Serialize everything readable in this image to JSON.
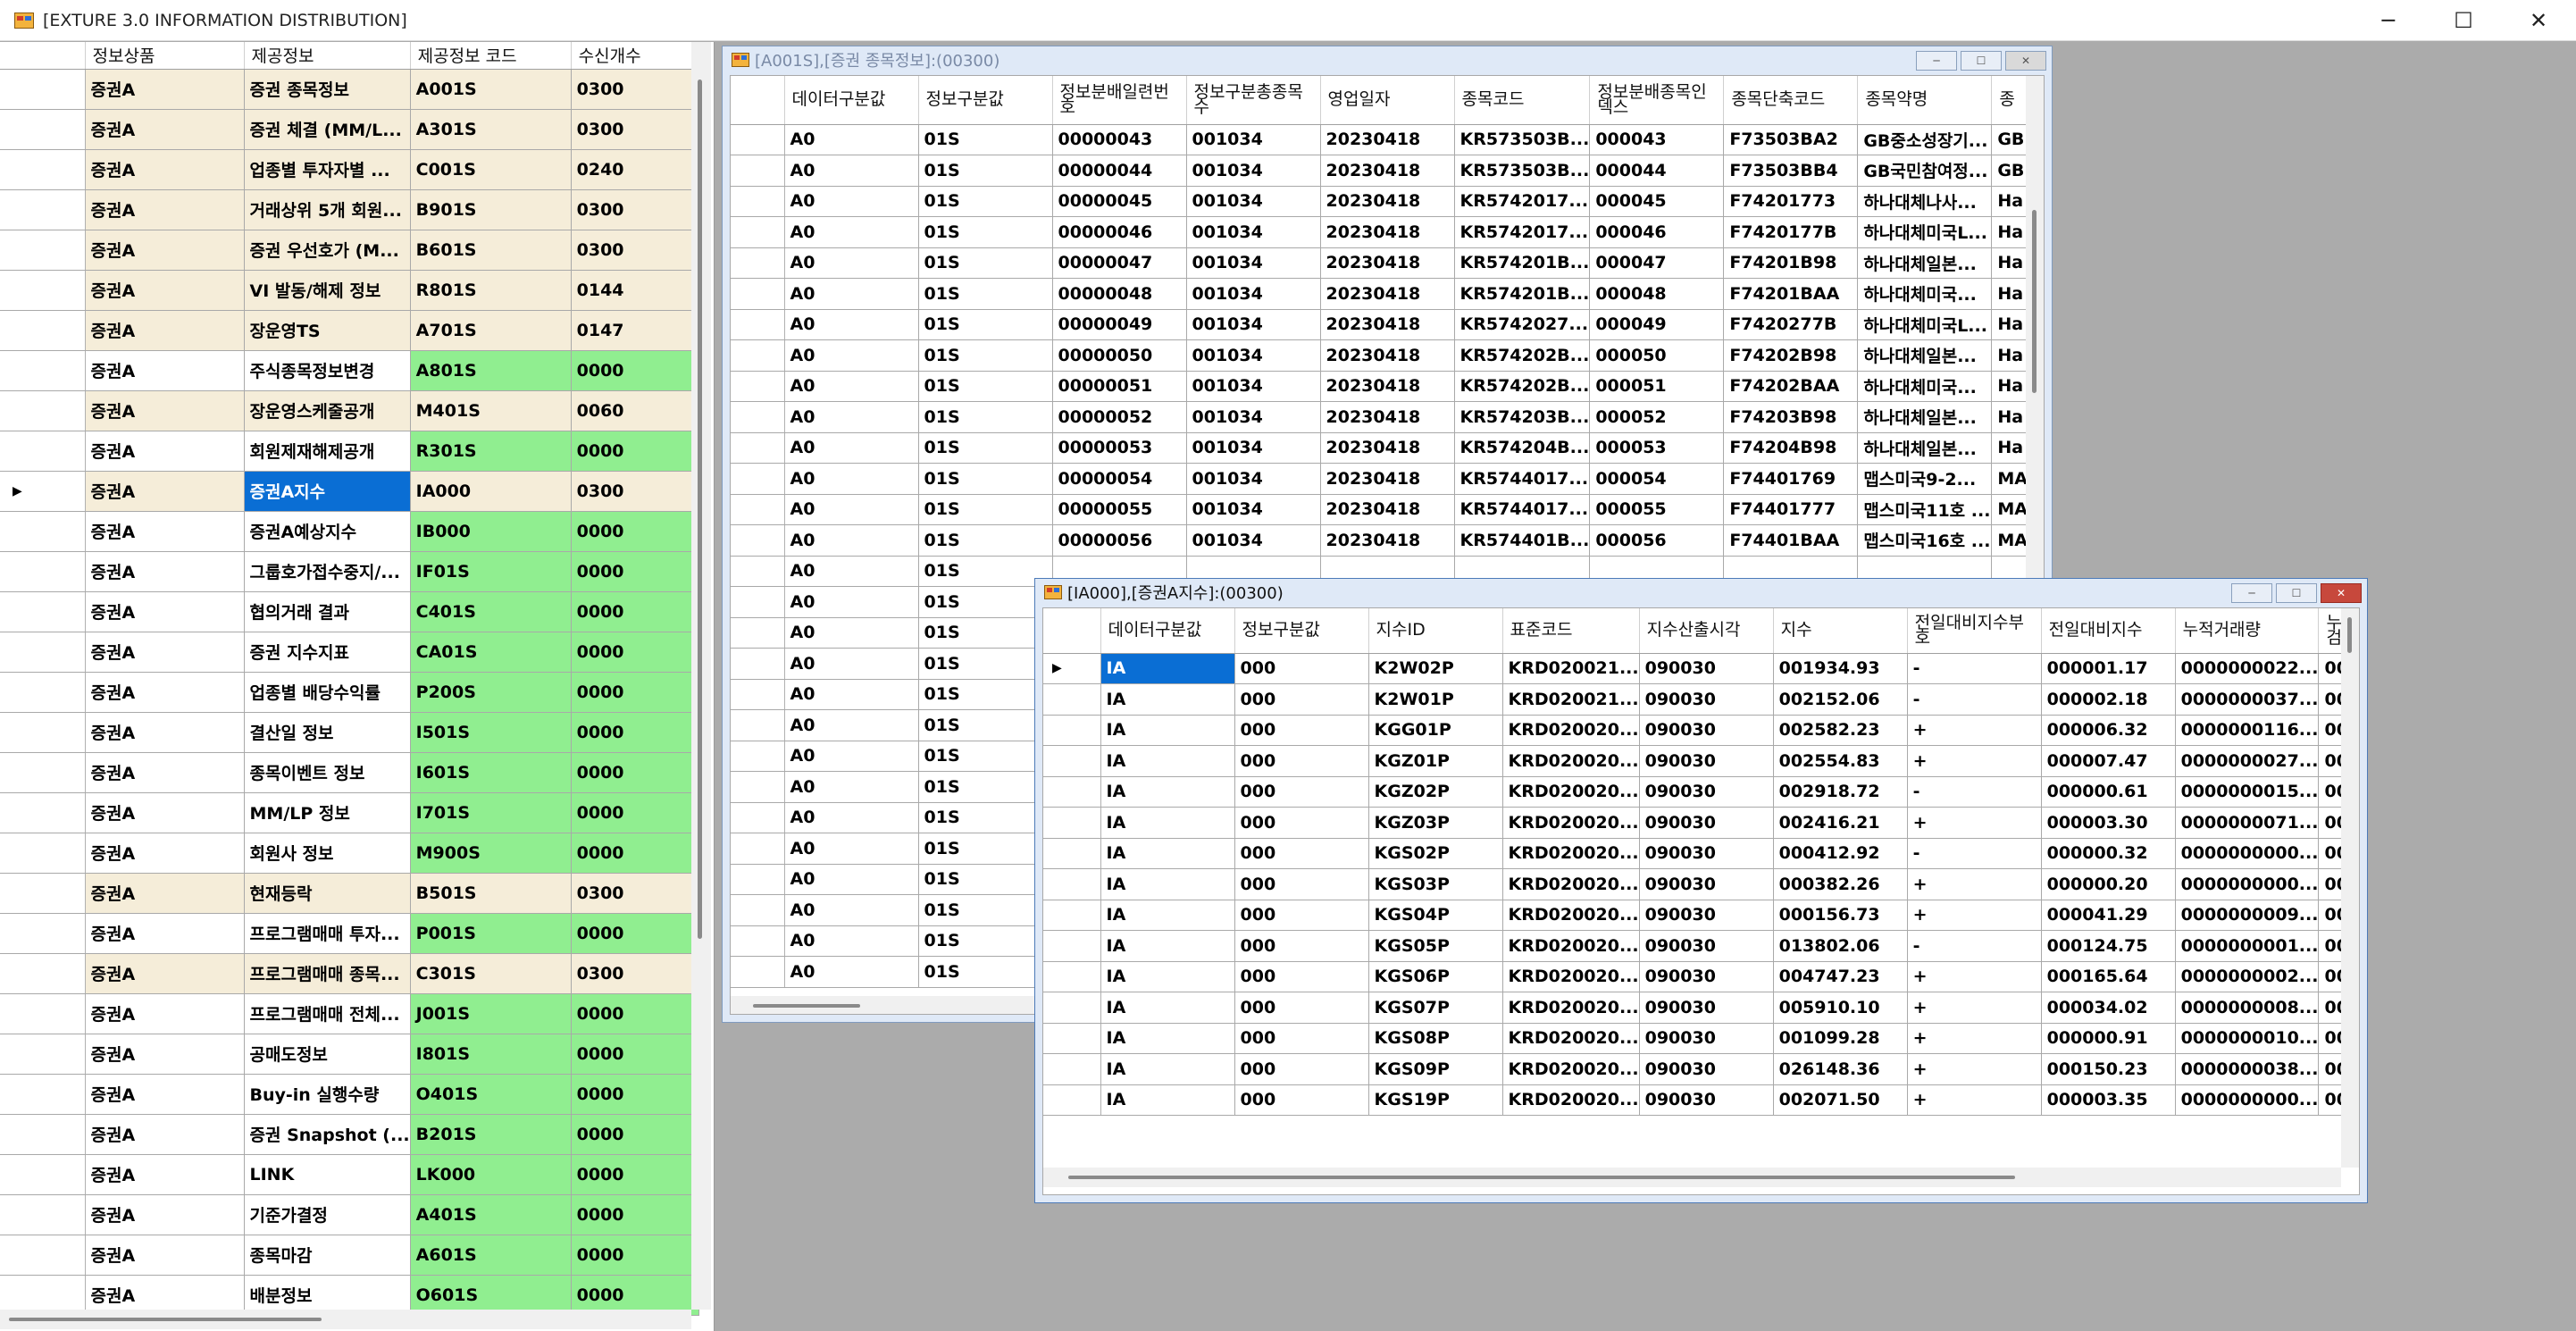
{
  "app": {
    "title": "[EXTURE 3.0 INFORMATION DISTRIBUTION]",
    "minimize": "─",
    "maximize": "☐",
    "close": "✕"
  },
  "colors": {
    "ok": "#90ee90",
    "default": "#f5edd9",
    "selection": "#0a6ed4"
  },
  "left_grid": {
    "columns": [
      "",
      "정보상품",
      "제공정보",
      "제공정보 코드",
      "수신개수"
    ],
    "rows": [
      {
        "product": "증권A",
        "info": "증권 종목정보",
        "code": "A001S",
        "count": "0300",
        "status": "default"
      },
      {
        "product": "증권A",
        "info": "증권 체결 (MM/L...",
        "code": "A301S",
        "count": "0300",
        "status": "default"
      },
      {
        "product": "증권A",
        "info": "업종별 투자자별 ...",
        "code": "C001S",
        "count": "0240",
        "status": "default"
      },
      {
        "product": "증권A",
        "info": "거래상위 5개 회원...",
        "code": "B901S",
        "count": "0300",
        "status": "default"
      },
      {
        "product": "증권A",
        "info": "증권 우선호가 (M...",
        "code": "B601S",
        "count": "0300",
        "status": "default"
      },
      {
        "product": "증권A",
        "info": "VI 발동/해제 정보",
        "code": "R801S",
        "count": "0144",
        "status": "default"
      },
      {
        "product": "증권A",
        "info": "장운영TS",
        "code": "A701S",
        "count": "0147",
        "status": "default"
      },
      {
        "product": "증권A",
        "info": "주식종목정보변경",
        "code": "A801S",
        "count": "0000",
        "status": "ok"
      },
      {
        "product": "증권A",
        "info": "장운영스케줄공개",
        "code": "M401S",
        "count": "0060",
        "status": "default"
      },
      {
        "product": "증권A",
        "info": "회원제재해제공개",
        "code": "R301S",
        "count": "0000",
        "status": "ok"
      },
      {
        "product": "증권A",
        "info": "증권A지수",
        "code": "IA000",
        "count": "0300",
        "status": "default",
        "selected": true,
        "current": true
      },
      {
        "product": "증권A",
        "info": "증권A예상지수",
        "code": "IB000",
        "count": "0000",
        "status": "ok"
      },
      {
        "product": "증권A",
        "info": "그룹호가접수중지/...",
        "code": "IF01S",
        "count": "0000",
        "status": "ok"
      },
      {
        "product": "증권A",
        "info": "협의거래 결과",
        "code": "C401S",
        "count": "0000",
        "status": "ok"
      },
      {
        "product": "증권A",
        "info": "증권 지수지표",
        "code": "CA01S",
        "count": "0000",
        "status": "ok"
      },
      {
        "product": "증권A",
        "info": "업종별 배당수익률",
        "code": "P200S",
        "count": "0000",
        "status": "ok"
      },
      {
        "product": "증권A",
        "info": "결산일 정보",
        "code": "I501S",
        "count": "0000",
        "status": "ok"
      },
      {
        "product": "증권A",
        "info": "종목이벤트 정보",
        "code": "I601S",
        "count": "0000",
        "status": "ok"
      },
      {
        "product": "증권A",
        "info": "MM/LP 정보",
        "code": "I701S",
        "count": "0000",
        "status": "ok"
      },
      {
        "product": "증권A",
        "info": "회원사 정보",
        "code": "M900S",
        "count": "0000",
        "status": "ok"
      },
      {
        "product": "증권A",
        "info": "현재등락",
        "code": "B501S",
        "count": "0300",
        "status": "default"
      },
      {
        "product": "증권A",
        "info": "프로그램매매 투자...",
        "code": "P001S",
        "count": "0000",
        "status": "ok"
      },
      {
        "product": "증권A",
        "info": "프로그램매매 종목...",
        "code": "C301S",
        "count": "0300",
        "status": "default"
      },
      {
        "product": "증권A",
        "info": "프로그램매매 전체...",
        "code": "J001S",
        "count": "0000",
        "status": "ok"
      },
      {
        "product": "증권A",
        "info": "공매도정보",
        "code": "I801S",
        "count": "0000",
        "status": "ok"
      },
      {
        "product": "증권A",
        "info": "Buy-in 실행수량",
        "code": "O401S",
        "count": "0000",
        "status": "ok"
      },
      {
        "product": "증권A",
        "info": "증권 Snapshot (...",
        "code": "B201S",
        "count": "0000",
        "status": "ok"
      },
      {
        "product": "증권A",
        "info": "LINK",
        "code": "LK000",
        "count": "0000",
        "status": "ok"
      },
      {
        "product": "증권A",
        "info": "기준가결정",
        "code": "A401S",
        "count": "0000",
        "status": "ok"
      },
      {
        "product": "증권A",
        "info": "종목마감",
        "code": "A601S",
        "count": "0000",
        "status": "ok"
      },
      {
        "product": "증권A",
        "info": "배분정보",
        "code": "O601S",
        "count": "0000",
        "status": "ok"
      }
    ]
  },
  "window_a001s": {
    "title": "[A001S],[증권 종목정보]:(00300)",
    "columns": [
      "",
      "데이터구분값",
      "정보구분값",
      "정보분배일련번호",
      "정보구분총종목수",
      "영업일자",
      "종목코드",
      "정보분배종목인덱스",
      "종목단축코드",
      "종목약명",
      "종"
    ],
    "rows": [
      [
        "A0",
        "01S",
        "00000043",
        "001034",
        "20230418",
        "KR573503B...",
        "000043",
        "F73503BA2",
        "GB중소성장기...",
        "GB"
      ],
      [
        "A0",
        "01S",
        "00000044",
        "001034",
        "20230418",
        "KR573503B...",
        "000044",
        "F73503BB4",
        "GB국민참여정...",
        "GB"
      ],
      [
        "A0",
        "01S",
        "00000045",
        "001034",
        "20230418",
        "KR5742017...",
        "000045",
        "F74201773",
        "하나대체나사...",
        "Ha"
      ],
      [
        "A0",
        "01S",
        "00000046",
        "001034",
        "20230418",
        "KR5742017...",
        "000046",
        "F7420177B",
        "하나대체미국L...",
        "Ha"
      ],
      [
        "A0",
        "01S",
        "00000047",
        "001034",
        "20230418",
        "KR574201B...",
        "000047",
        "F74201B98",
        "하나대체일본...",
        "Ha"
      ],
      [
        "A0",
        "01S",
        "00000048",
        "001034",
        "20230418",
        "KR574201B...",
        "000048",
        "F74201BAA",
        "하나대체미국...",
        "Ha"
      ],
      [
        "A0",
        "01S",
        "00000049",
        "001034",
        "20230418",
        "KR5742027...",
        "000049",
        "F7420277B",
        "하나대체미국L...",
        "Ha"
      ],
      [
        "A0",
        "01S",
        "00000050",
        "001034",
        "20230418",
        "KR574202B...",
        "000050",
        "F74202B98",
        "하나대체일본...",
        "Ha"
      ],
      [
        "A0",
        "01S",
        "00000051",
        "001034",
        "20230418",
        "KR574202B...",
        "000051",
        "F74202BAA",
        "하나대체미국...",
        "Ha"
      ],
      [
        "A0",
        "01S",
        "00000052",
        "001034",
        "20230418",
        "KR574203B...",
        "000052",
        "F74203B98",
        "하나대체일본...",
        "Ha"
      ],
      [
        "A0",
        "01S",
        "00000053",
        "001034",
        "20230418",
        "KR574204B...",
        "000053",
        "F74204B98",
        "하나대체일본...",
        "Ha"
      ],
      [
        "A0",
        "01S",
        "00000054",
        "001034",
        "20230418",
        "KR5744017...",
        "000054",
        "F74401769",
        "맵스미국9-2...",
        "MA"
      ],
      [
        "A0",
        "01S",
        "00000055",
        "001034",
        "20230418",
        "KR5744017...",
        "000055",
        "F74401777",
        "맵스미국11호 ...",
        "MA"
      ],
      [
        "A0",
        "01S",
        "00000056",
        "001034",
        "20230418",
        "KR574401B...",
        "000056",
        "F74401BAA",
        "맵스미국16호 ...",
        "MA"
      ],
      [
        "A0",
        "01S",
        "",
        "",
        "",
        "",
        "",
        "",
        "",
        ""
      ],
      [
        "A0",
        "01S",
        "",
        "",
        "",
        "",
        "",
        "",
        "",
        ""
      ],
      [
        "A0",
        "01S",
        "",
        "",
        "",
        "",
        "",
        "",
        "",
        ""
      ],
      [
        "A0",
        "01S",
        "",
        "",
        "",
        "",
        "",
        "",
        "",
        ""
      ],
      [
        "A0",
        "01S",
        "",
        "",
        "",
        "",
        "",
        "",
        "",
        ""
      ],
      [
        "A0",
        "01S",
        "",
        "",
        "",
        "",
        "",
        "",
        "",
        ""
      ],
      [
        "A0",
        "01S",
        "",
        "",
        "",
        "",
        "",
        "",
        "",
        ""
      ],
      [
        "A0",
        "01S",
        "",
        "",
        "",
        "",
        "",
        "",
        "",
        ""
      ],
      [
        "A0",
        "01S",
        "",
        "",
        "",
        "",
        "",
        "",
        "",
        ""
      ],
      [
        "A0",
        "01S",
        "",
        "",
        "",
        "",
        "",
        "",
        "",
        ""
      ],
      [
        "A0",
        "01S",
        "",
        "",
        "",
        "",
        "",
        "",
        "",
        ""
      ],
      [
        "A0",
        "01S",
        "",
        "",
        "",
        "",
        "",
        "",
        "",
        ""
      ],
      [
        "A0",
        "01S",
        "",
        "",
        "",
        "",
        "",
        "",
        "",
        ""
      ],
      [
        "A0",
        "01S",
        "",
        "",
        "",
        "",
        "",
        "",
        "",
        ""
      ]
    ]
  },
  "window_ia000": {
    "title": "[IA000],[증권A지수]:(00300)",
    "columns": [
      "",
      "데이터구분값",
      "정보구분값",
      "지수ID",
      "표준코드",
      "지수산출시각",
      "지수",
      "전일대비지수부호",
      "전일대비지수",
      "누적거래량",
      "누검"
    ],
    "rows": [
      [
        "IA",
        "000",
        "K2W02P",
        "KRD020021...",
        "090030",
        "001934.93",
        "-",
        "000001.17",
        "0000000022...",
        "00"
      ],
      [
        "IA",
        "000",
        "K2W01P",
        "KRD020021...",
        "090030",
        "002152.06",
        "-",
        "000002.18",
        "0000000037...",
        "00"
      ],
      [
        "IA",
        "000",
        "KGG01P",
        "KRD020020...",
        "090030",
        "002582.23",
        "+",
        "000006.32",
        "0000000116...",
        "00"
      ],
      [
        "IA",
        "000",
        "KGZ01P",
        "KRD020020...",
        "090030",
        "002554.83",
        "+",
        "000007.47",
        "0000000027...",
        "00"
      ],
      [
        "IA",
        "000",
        "KGZ02P",
        "KRD020020...",
        "090030",
        "002918.72",
        "-",
        "000000.61",
        "0000000015...",
        "00"
      ],
      [
        "IA",
        "000",
        "KGZ03P",
        "KRD020020...",
        "090030",
        "002416.21",
        "+",
        "000003.30",
        "0000000071...",
        "00"
      ],
      [
        "IA",
        "000",
        "KGS02P",
        "KRD020020...",
        "090030",
        "000412.92",
        "-",
        "000000.32",
        "0000000000...",
        "00"
      ],
      [
        "IA",
        "000",
        "KGS03P",
        "KRD020020...",
        "090030",
        "000382.26",
        "+",
        "000000.20",
        "0000000000...",
        "00"
      ],
      [
        "IA",
        "000",
        "KGS04P",
        "KRD020020...",
        "090030",
        "000156.73",
        "+",
        "000041.29",
        "0000000009...",
        "00"
      ],
      [
        "IA",
        "000",
        "KGS05P",
        "KRD020020...",
        "090030",
        "013802.06",
        "-",
        "000124.75",
        "0000000001...",
        "00"
      ],
      [
        "IA",
        "000",
        "KGS06P",
        "KRD020020...",
        "090030",
        "004747.23",
        "+",
        "000165.64",
        "0000000002...",
        "00"
      ],
      [
        "IA",
        "000",
        "KGS07P",
        "KRD020020...",
        "090030",
        "005910.10",
        "+",
        "000034.02",
        "0000000008...",
        "00"
      ],
      [
        "IA",
        "000",
        "KGS08P",
        "KRD020020...",
        "090030",
        "001099.28",
        "+",
        "000000.91",
        "0000000010...",
        "00"
      ],
      [
        "IA",
        "000",
        "KGS09P",
        "KRD020020...",
        "090030",
        "026148.36",
        "+",
        "000150.23",
        "0000000038...",
        "00"
      ],
      [
        "IA",
        "000",
        "KGS19P",
        "KRD020020...",
        "090030",
        "002071.50",
        "+",
        "000003.35",
        "0000000000...",
        "00"
      ]
    ]
  }
}
